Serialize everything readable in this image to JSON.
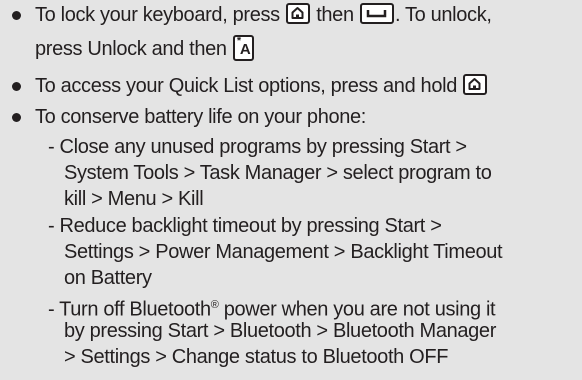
{
  "bullets": [
    {
      "line1_a": "To lock your keyboard, press",
      "line1_b": "then",
      "line1_c": ". To unlock,",
      "line2_a": "press Unlock and then",
      "keys": {
        "home": "home-key",
        "space": "space-key",
        "star": "star-a-key"
      },
      "star_key_star": "*",
      "star_key_letter": "A"
    },
    {
      "line1_a": "To access your Quick List options, press and hold",
      "keys": {
        "home": "home-key"
      }
    },
    {
      "line1_a": "To conserve battery life on your phone:",
      "sub_items": [
        {
          "lines": [
            "- Close any unused programs by pressing Start >",
            "System Tools > Task Manager > select program to",
            "kill > Menu > Kill"
          ]
        },
        {
          "lines": [
            "- Reduce backlight timeout by pressing Start >",
            "Settings > Power Management > Backlight Timeout",
            "on Battery"
          ]
        },
        {
          "lines_before": "- Turn off Bluetooth",
          "registered": "®",
          "lines_after": " power when you are not using it",
          "lines": [
            "by pressing Start > Bluetooth > Bluetooth Manager",
            "> Settings > Change status to Bluetooth OFF"
          ]
        }
      ]
    }
  ]
}
